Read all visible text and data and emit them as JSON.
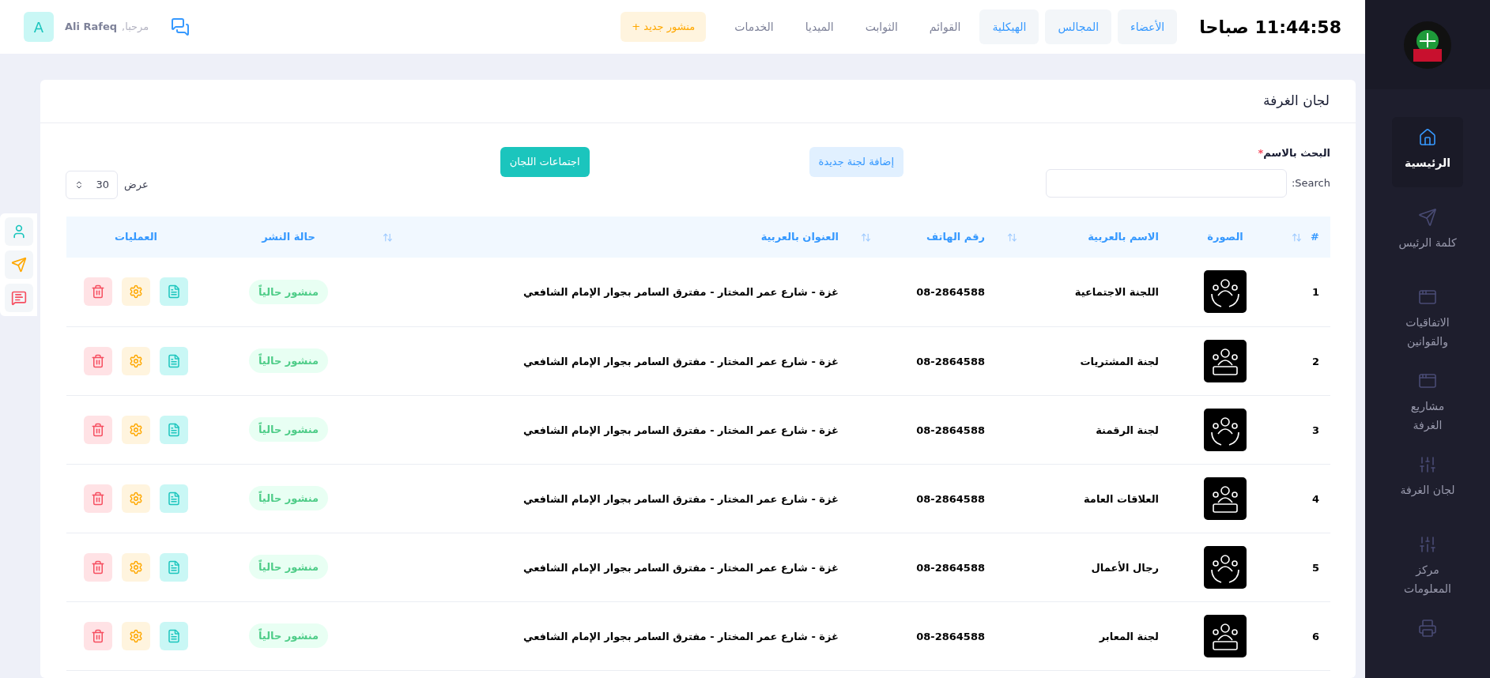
{
  "topbar": {
    "clock": "11:44:58 صباحا",
    "nav": [
      {
        "label": "الأعضاء",
        "selected": true
      },
      {
        "label": "المجالس",
        "selected": true
      },
      {
        "label": "الهيكلية",
        "selected": true
      },
      {
        "label": "القوائم",
        "selected": false
      },
      {
        "label": "الثوابت",
        "selected": false
      },
      {
        "label": "الميديا",
        "selected": false
      },
      {
        "label": "الخدمات",
        "selected": false
      }
    ],
    "new_post_button": "منشور جديد +",
    "greeting": "مرحبا,",
    "user_name": "Ali Rafeq",
    "avatar_letter": "A"
  },
  "sidebar": {
    "items": [
      {
        "label": "الرئيسية",
        "selected": true
      },
      {
        "label": "كلمة الرئيس",
        "selected": false
      },
      {
        "label": "الاتفاقيات والقوانين",
        "selected": false
      },
      {
        "label": "مشاريع الغرفة",
        "selected": false
      },
      {
        "label": "لجان الغرفة",
        "selected": false
      },
      {
        "label": "مركز المعلومات",
        "selected": false
      },
      {
        "selected": false
      }
    ]
  },
  "card": {
    "title": "لجان الغرفة",
    "search_label": "البحث بالاسم",
    "required_mark": "*",
    "add_button": "إضافة لجنة جديدة",
    "meetings_button": "اجتماعات اللجان",
    "search_caption": "Search:",
    "page_size_label": "عرض",
    "page_size": "30",
    "table": {
      "columns": [
        {
          "label": "#",
          "sortable": true
        },
        {
          "label": "الصورة",
          "sortable": false
        },
        {
          "label": "الاسم بالعربية",
          "sortable": true
        },
        {
          "label": "رقم الهاتف",
          "sortable": true
        },
        {
          "label": "العنوان بالعربية",
          "sortable": true
        },
        {
          "label": "حالة النشر",
          "sortable": false
        },
        {
          "label": "العمليات",
          "sortable": false
        }
      ],
      "rows": [
        {
          "index": "1",
          "name": "اللجنة الاجتماعية",
          "phone": "08-2864588",
          "address": "غزة - شارع عمر المختار - مفترق السامر بجوار الإمام الشافعي",
          "status": "منشور حالياً"
        },
        {
          "index": "2",
          "name": "لجنة المشتريات",
          "phone": "08-2864588",
          "address": "غزة - شارع عمر المختار - مفترق السامر بجوار الإمام الشافعي",
          "status": "منشور حالياً"
        },
        {
          "index": "3",
          "name": "لجنة الرقمنة",
          "phone": "08-2864588",
          "address": "غزة - شارع عمر المختار - مفترق السامر بجوار الإمام الشافعي",
          "status": "منشور حالياً"
        },
        {
          "index": "4",
          "name": "العلاقات العامة",
          "phone": "08-2864588",
          "address": "غزة - شارع عمر المختار - مفترق السامر بجوار الإمام الشافعي",
          "status": "منشور حالياً"
        },
        {
          "index": "5",
          "name": "رجال الأعمال",
          "phone": "08-2864588",
          "address": "غزة - شارع عمر المختار - مفترق السامر بجوار الإمام الشافعي",
          "status": "منشور حالياً"
        },
        {
          "index": "6",
          "name": "لجنة المعابر",
          "phone": "08-2864588",
          "address": "غزة - شارع عمر المختار - مفترق السامر بجوار الإمام الشافعي",
          "status": "منشور حالياً"
        }
      ]
    }
  }
}
